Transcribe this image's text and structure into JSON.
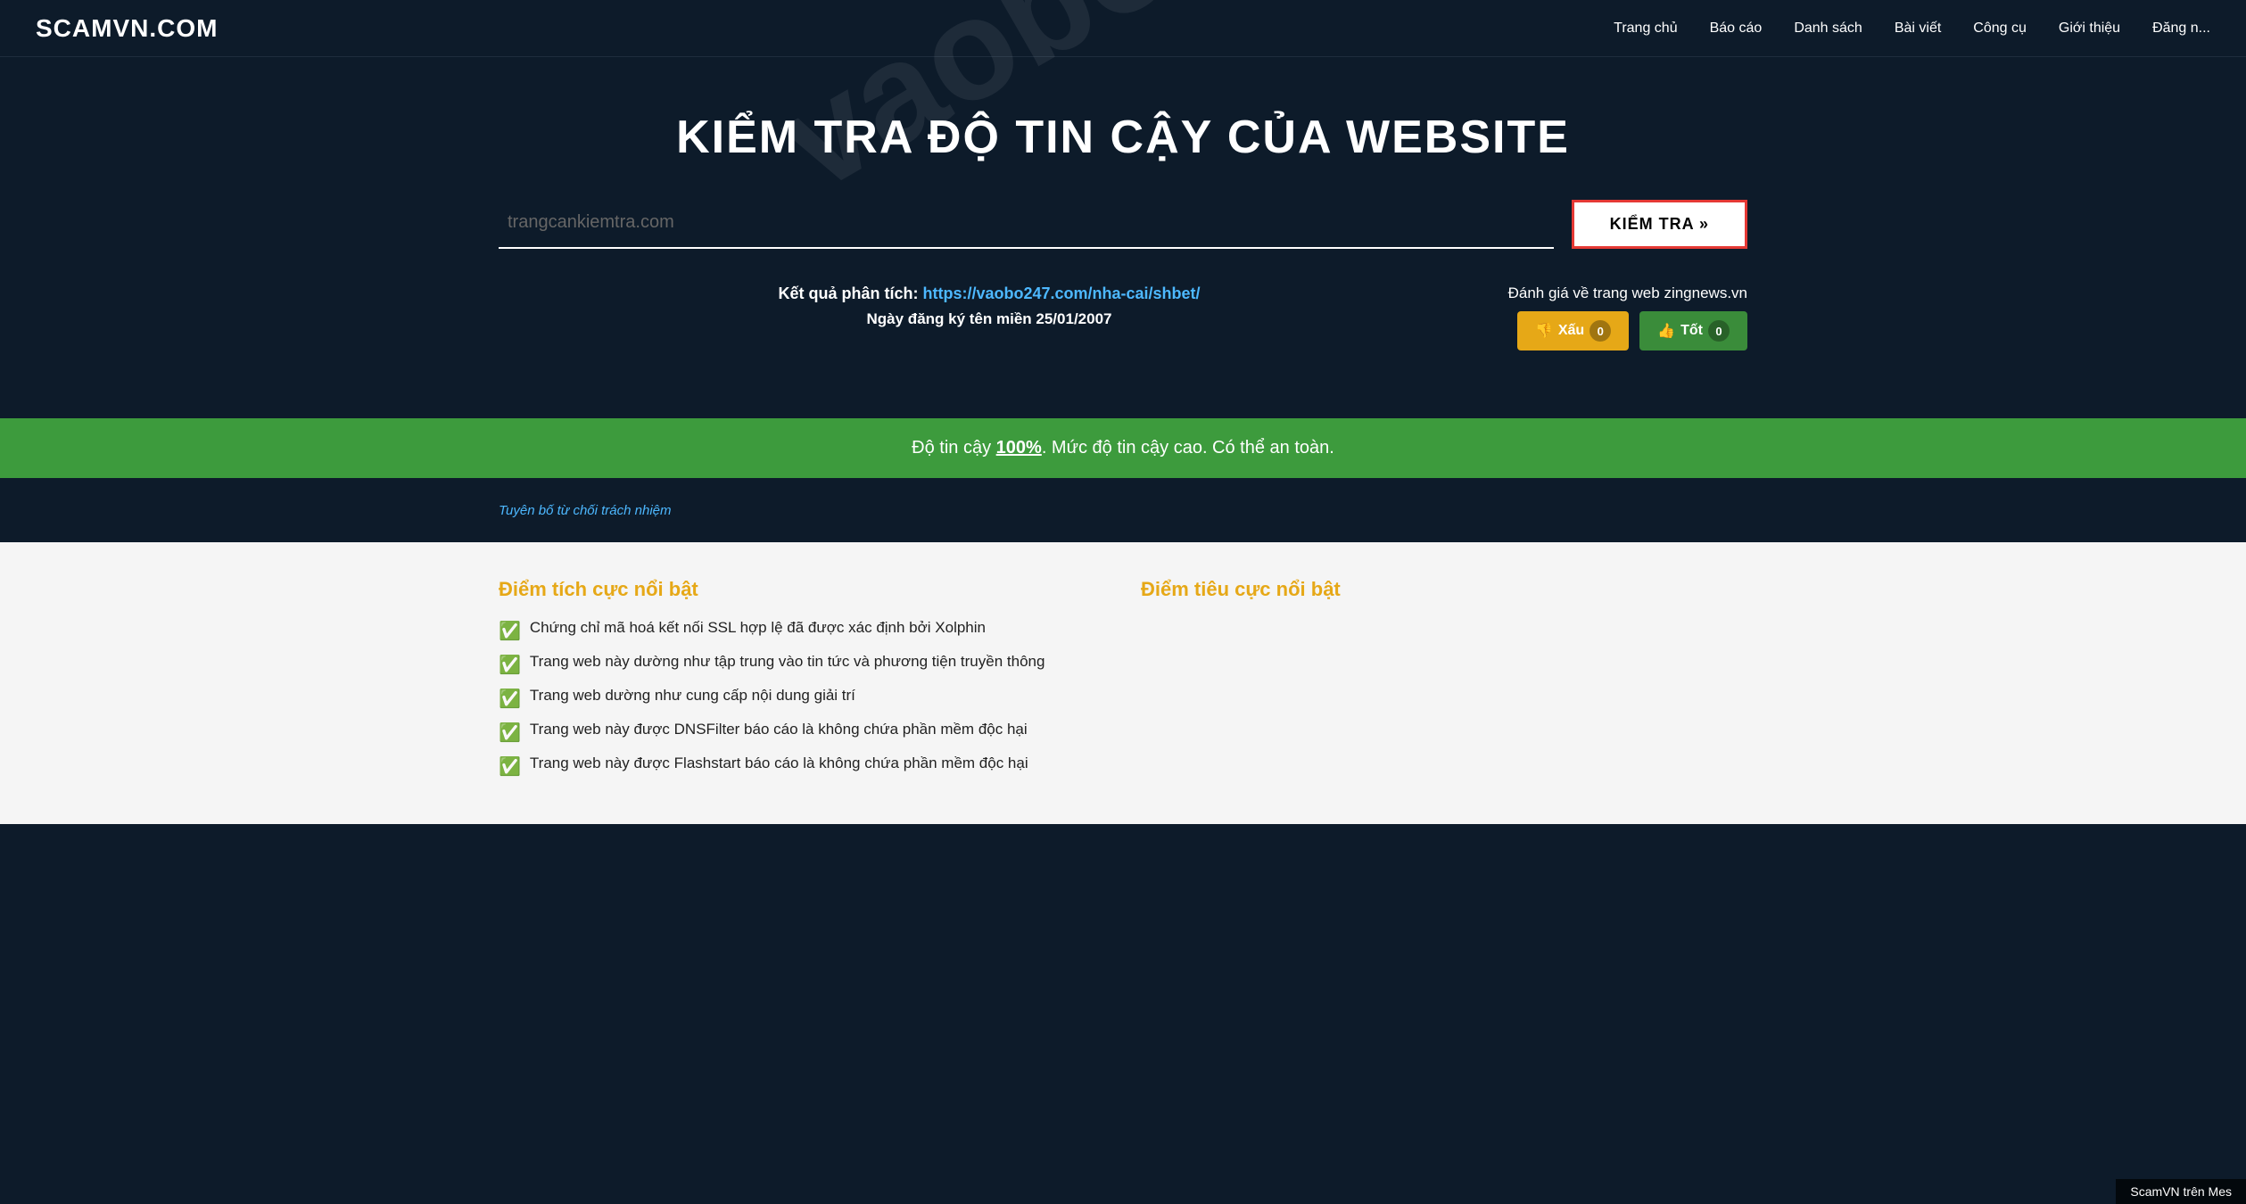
{
  "site": {
    "logo": "SCAMVN.COM"
  },
  "nav": {
    "items": [
      {
        "label": "Trang chủ",
        "href": "#"
      },
      {
        "label": "Báo cáo",
        "href": "#"
      },
      {
        "label": "Danh sách",
        "href": "#"
      },
      {
        "label": "Bài viết",
        "href": "#"
      },
      {
        "label": "Công cụ",
        "href": "#"
      },
      {
        "label": "Giới thiệu",
        "href": "#"
      },
      {
        "label": "Đăng n...",
        "href": "#"
      }
    ]
  },
  "hero": {
    "title": "KIỂM TRA ĐỘ TIN CẬY CỦA WEBSITE"
  },
  "search": {
    "placeholder": "trangcankiemtra.com",
    "button_label": "KIỂM TRA »"
  },
  "result": {
    "label": "Kết quả phân tích:",
    "url": "https://vaobo247.com/nha-cai/shbet/",
    "date_label": "Ngày đăng ký tên miền 25/01/2007",
    "rating_label": "Đánh giá về trang web zingnews.vn",
    "btn_bad_label": "Xấu",
    "btn_bad_count": "0",
    "btn_good_label": "Tốt",
    "btn_good_count": "0"
  },
  "trust": {
    "text_before": "Độ tin cậy ",
    "percent": "100%",
    "text_after": ". Mức độ tin cậy cao. Có thể an toàn."
  },
  "disclaimer": {
    "link_text": "Tuyên bố từ chối trách nhiệm"
  },
  "positives": {
    "heading": "Điểm tích cực nổi bật",
    "items": [
      "Chứng chỉ mã hoá kết nối SSL hợp lệ đã được xác định bởi Xolphin",
      "Trang web này dường như tập trung vào tin tức và phương tiện truyền thông",
      "Trang web dường như cung cấp nội dung giải trí",
      "Trang web này được DNSFilter báo cáo là không chứa phần mềm độc hại",
      "Trang web này được Flashstart báo cáo là không chứa phần mềm độc hại"
    ]
  },
  "negatives": {
    "heading": "Điểm tiêu cực nổi bật",
    "items": []
  },
  "footer_hint": "ScamVN trên Mes"
}
